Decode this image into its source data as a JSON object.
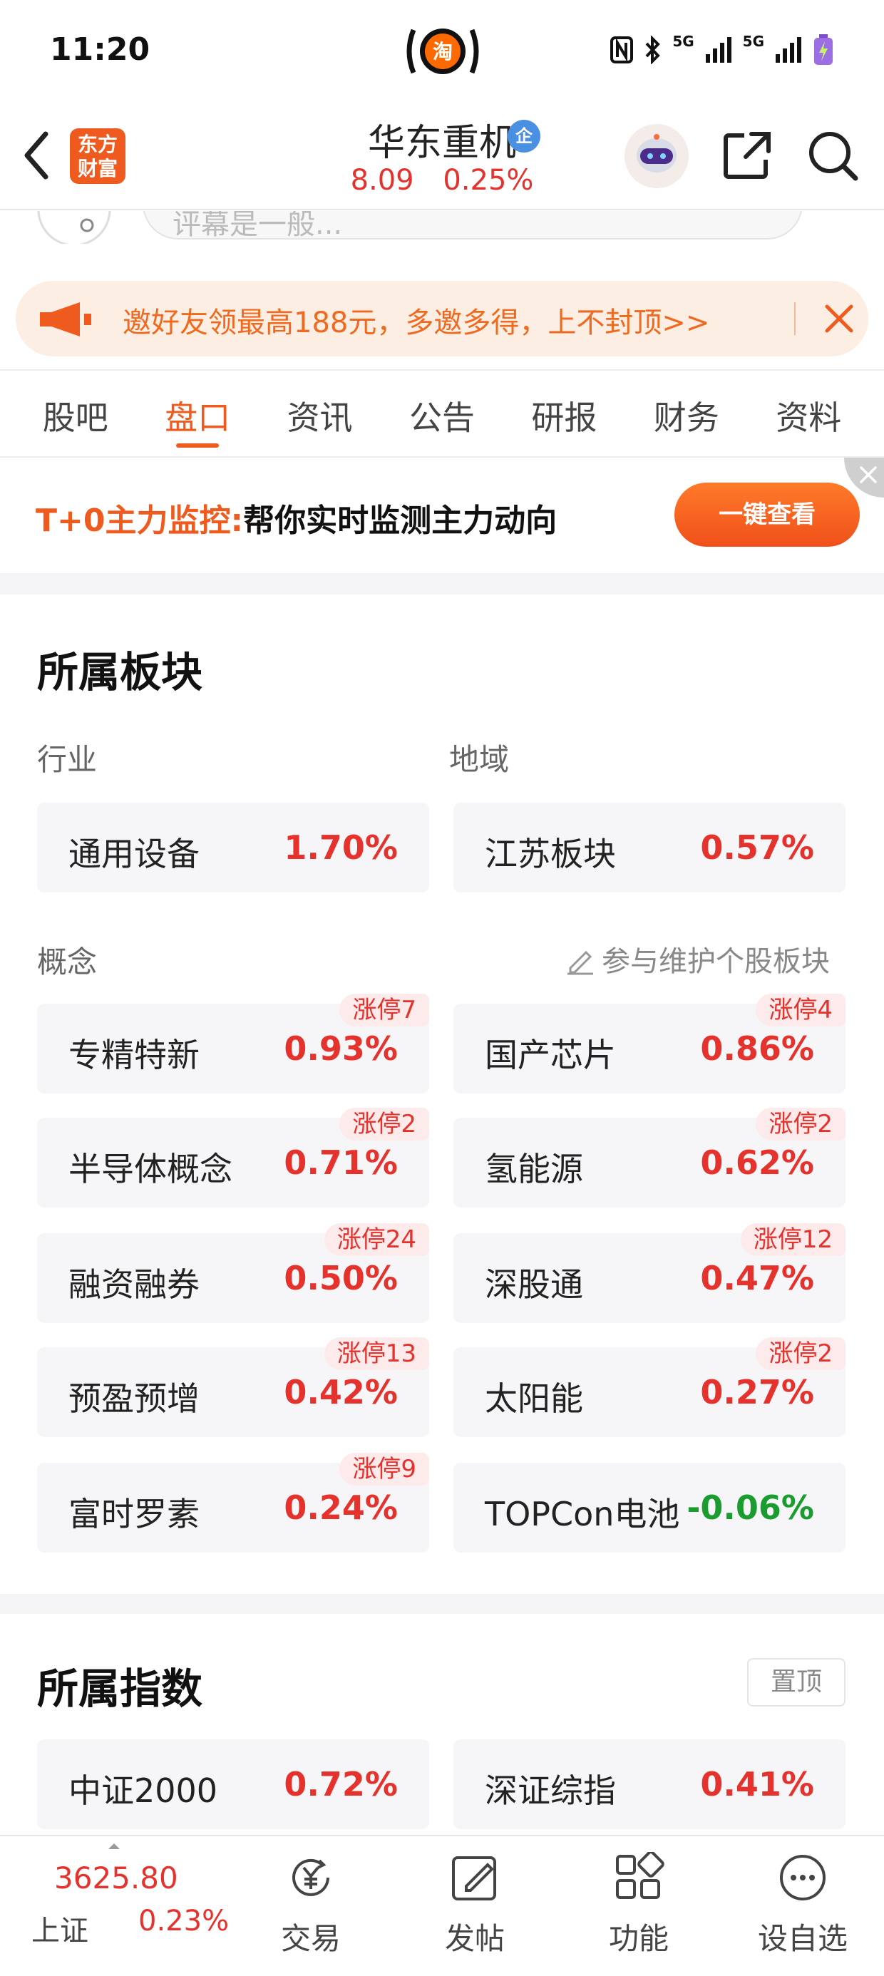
{
  "status_bar": {
    "time": "11:20",
    "center_app_icon": "taobao-icon",
    "icons": [
      "nfc-icon",
      "bluetooth-icon",
      "5g-signal-icon",
      "5g-signal-icon",
      "battery-charging-icon"
    ],
    "signal_label_1": "5G",
    "signal_label_2": "5G"
  },
  "header": {
    "brand_line1": "东方",
    "brand_line2": "财富",
    "stock_name": "华东重机",
    "badge": "企",
    "price": "8.09",
    "change_pct": "0.25%"
  },
  "hidden_search": {
    "text": "评幕是一般..."
  },
  "invite_banner": {
    "text": "邀好友领最高188元，多邀多得，上不封顶>>"
  },
  "tabs": [
    {
      "label": "股吧",
      "active": false
    },
    {
      "label": "盘口",
      "active": true
    },
    {
      "label": "资讯",
      "active": false
    },
    {
      "label": "公告",
      "active": false
    },
    {
      "label": "研报",
      "active": false
    },
    {
      "label": "财务",
      "active": false
    },
    {
      "label": "资料",
      "active": false
    }
  ],
  "ad": {
    "title": "T+0主力监控:",
    "subtitle": "帮你实时监测主力动向",
    "button": "一键查看"
  },
  "sectors": {
    "title": "所属板块",
    "industry_label": "行业",
    "region_label": "地域",
    "industry": {
      "name": "通用设备",
      "pct": "1.70%"
    },
    "region": {
      "name": "江苏板块",
      "pct": "0.57%"
    },
    "concept_label": "概念",
    "maintain_label": "参与维护个股板块",
    "concepts": [
      {
        "name": "专精特新",
        "pct": "0.93%",
        "limit": "涨停7"
      },
      {
        "name": "国产芯片",
        "pct": "0.86%",
        "limit": "涨停4"
      },
      {
        "name": "半导体概念",
        "pct": "0.71%",
        "limit": "涨停2"
      },
      {
        "name": "氢能源",
        "pct": "0.62%",
        "limit": "涨停2"
      },
      {
        "name": "融资融券",
        "pct": "0.50%",
        "limit": "涨停24"
      },
      {
        "name": "深股通",
        "pct": "0.47%",
        "limit": "涨停12"
      },
      {
        "name": "预盈预增",
        "pct": "0.42%",
        "limit": "涨停13"
      },
      {
        "name": "太阳能",
        "pct": "0.27%",
        "limit": "涨停2"
      },
      {
        "name": "富时罗素",
        "pct": "0.24%",
        "limit": "涨停9"
      },
      {
        "name": "TOPCon电池",
        "pct": "-0.06%",
        "limit": ""
      }
    ]
  },
  "indices": {
    "title": "所属指数",
    "pin_label": "置顶",
    "items": [
      {
        "name": "中证2000",
        "pct": "0.72%"
      },
      {
        "name": "深证综指",
        "pct": "0.41%"
      }
    ]
  },
  "bottom_nav": {
    "index_value": "3625.80",
    "index_name": "上证",
    "index_pct": "0.23%",
    "items": [
      {
        "label": "交易",
        "icon": "yen-exchange-icon"
      },
      {
        "label": "发帖",
        "icon": "edit-icon"
      },
      {
        "label": "功能",
        "icon": "grid-icon"
      },
      {
        "label": "设自选",
        "icon": "more-icon"
      }
    ]
  },
  "colors": {
    "accent": "#ef5a1f",
    "up": "#e5322d",
    "down": "#1a9c2e"
  }
}
